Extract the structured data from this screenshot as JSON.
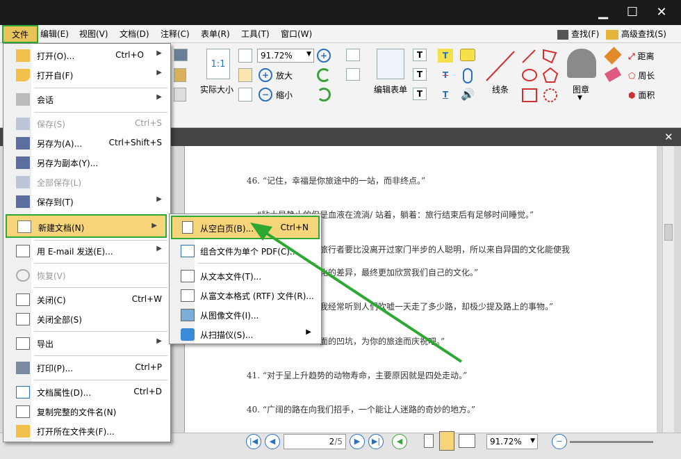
{
  "window": {
    "minimize": "▁",
    "maximize": "☐",
    "close": "✕"
  },
  "menubar": {
    "items": [
      "文件",
      "编辑(E)",
      "视图(V)",
      "文档(D)",
      "注释(C)",
      "表单(R)",
      "工具(T)",
      "窗口(W)"
    ],
    "find": "查找(F)",
    "adv_find": "高级查找(S)"
  },
  "toolbar": {
    "zoom": "91.72%",
    "actual_size": "实际大小",
    "zoom_in": "放大",
    "zoom_out": "缩小",
    "edit_form": "编辑表单",
    "line": "线条",
    "stamp": "图章",
    "distance": "距离",
    "perimeter": "周长",
    "area": "面积"
  },
  "file_menu": {
    "items": [
      {
        "label": "打开(O)...",
        "shortcut": "Ctrl+O",
        "arrow": "▶",
        "icon": "folder-open-icon"
      },
      {
        "label": "打开自(F)",
        "shortcut": "",
        "arrow": "▶",
        "icon": "globe-folder-icon"
      },
      {
        "label": "会话",
        "shortcut": "",
        "arrow": "▶",
        "icon": "session-icon"
      },
      {
        "label": "保存(S)",
        "shortcut": "Ctrl+S",
        "arrow": "",
        "icon": "save-icon"
      },
      {
        "label": "另存为(A)...",
        "shortcut": "Ctrl+Shift+S",
        "arrow": "",
        "icon": "save-as-icon"
      },
      {
        "label": "另存为副本(Y)...",
        "shortcut": "",
        "arrow": "",
        "icon": "save-copy-icon"
      },
      {
        "label": "全部保存(L)",
        "shortcut": "",
        "arrow": "",
        "icon": "save-all-icon"
      },
      {
        "label": "保存到(T)",
        "shortcut": "",
        "arrow": "▶",
        "icon": "save-to-icon"
      },
      {
        "label": "新建文档(N)",
        "shortcut": "",
        "arrow": "▶",
        "icon": "new-document-icon"
      },
      {
        "label": "用 E-mail 发送(E)...",
        "shortcut": "",
        "arrow": "▶",
        "icon": "email-icon"
      },
      {
        "label": "恢复(V)",
        "shortcut": "",
        "arrow": "",
        "icon": "revert-icon"
      },
      {
        "label": "关闭(C)",
        "shortcut": "Ctrl+W",
        "arrow": "",
        "icon": "close-doc-icon"
      },
      {
        "label": "关闭全部(S)",
        "shortcut": "",
        "arrow": "",
        "icon": "close-all-icon"
      },
      {
        "label": "导出",
        "shortcut": "",
        "arrow": "▶",
        "icon": "export-icon"
      },
      {
        "label": "打印(P)...",
        "shortcut": "Ctrl+P",
        "arrow": "",
        "icon": "print-icon"
      },
      {
        "label": "文档属性(D)...",
        "shortcut": "Ctrl+D",
        "arrow": "",
        "icon": "properties-icon"
      },
      {
        "label": "复制完整的文件名(N)",
        "shortcut": "",
        "arrow": "",
        "icon": "copy-filename-icon"
      },
      {
        "label": "打开所在文件夹(F)...",
        "shortcut": "",
        "arrow": "",
        "icon": "open-folder-icon"
      }
    ]
  },
  "new_doc_menu": {
    "items": [
      {
        "label": "从空白页(B)...",
        "shortcut": "Ctrl+N",
        "arrow": ""
      },
      {
        "label": "组合文件为单个 PDF(C)...",
        "shortcut": "",
        "arrow": ""
      },
      {
        "label": "从文本文件(T)...",
        "shortcut": "",
        "arrow": ""
      },
      {
        "label": "从富文本格式 (RTF) 文件(R)...",
        "shortcut": "",
        "arrow": ""
      },
      {
        "label": "从图像文件(I)...",
        "shortcut": "",
        "arrow": ""
      },
      {
        "label": "从扫描仪(S)...",
        "shortcut": "",
        "arrow": "▶"
      }
    ]
  },
  "document": {
    "lines": [
      "46. “记住，幸福是你旅途中的一站，而非终点。”",
      "“粘土是静止的但是血液在流淌/ 站着，躺着：旅行结束后有足够时间睡觉。”",
      "旅行者要比没离开过家门半步的人聪明，所以来自异国的文化能使我",
      "化的差异，最终更加欣赏我们自己的文化。”",
      "我经常听到人们吹嘘一天走了多少路，却极少提及路上的事物。”",
      "面的凹坑，为你的旅途而庆祝吧。”",
      "41. “对于呈上升趋势的动物寿命，主要原因就是四处走动。”",
      "40. “广阔的路在向我们招手，一个能让人迷路的奇妙的地方。”"
    ]
  },
  "status": {
    "page": "2",
    "total": "/5",
    "zoom": "91.72%"
  },
  "annotation_color": "#2da832"
}
